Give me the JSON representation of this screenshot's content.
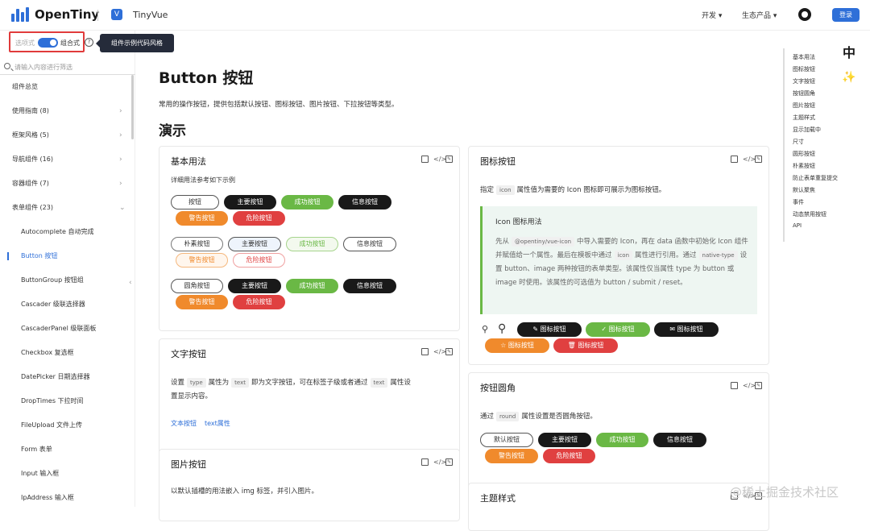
{
  "header": {
    "brand": "OpenTiny",
    "product": "TinyVue",
    "nav_dev": "开发 ▾",
    "nav_eco": "生态产品 ▾",
    "login": "登录"
  },
  "sidebar": {
    "mode_options": "选项式",
    "mode_composition": "组合式",
    "tooltip": "组件示例代码风格",
    "search_placeholder": "请输入内容进行筛选",
    "items": [
      {
        "label": "组件总览",
        "sub": false,
        "chev": ""
      },
      {
        "label": "使用指南 (8)",
        "sub": false,
        "chev": "›"
      },
      {
        "label": "框架风格 (5)",
        "sub": false,
        "chev": "›"
      },
      {
        "label": "导航组件 (16)",
        "sub": false,
        "chev": "›"
      },
      {
        "label": "容器组件 (7)",
        "sub": false,
        "chev": "›"
      },
      {
        "label": "表单组件 (23)",
        "sub": false,
        "chev": "⌄"
      },
      {
        "label": "Autocomplete 自动完成",
        "sub": true,
        "chev": ""
      },
      {
        "label": "Button 按钮",
        "sub": true,
        "chev": "",
        "active": true
      },
      {
        "label": "ButtonGroup 按钮组",
        "sub": true,
        "chev": ""
      },
      {
        "label": "Cascader 级联选择器",
        "sub": true,
        "chev": ""
      },
      {
        "label": "CascaderPanel 级联面板",
        "sub": true,
        "chev": ""
      },
      {
        "label": "Checkbox 复选框",
        "sub": true,
        "chev": ""
      },
      {
        "label": "DatePicker 日期选择器",
        "sub": true,
        "chev": ""
      },
      {
        "label": "DropTimes 下拉时间",
        "sub": true,
        "chev": ""
      },
      {
        "label": "FileUpload 文件上传",
        "sub": true,
        "chev": ""
      },
      {
        "label": "Form 表单",
        "sub": true,
        "chev": ""
      },
      {
        "label": "Input 输入框",
        "sub": true,
        "chev": ""
      },
      {
        "label": "IpAddress 输入框",
        "sub": true,
        "chev": ""
      }
    ]
  },
  "page": {
    "title": "Button 按钮",
    "desc": "常用的操作按钮，提供包括默认按钮、图标按钮、图片按钮、下拉按钮等类型。",
    "demo_heading": "演示"
  },
  "card_basic": {
    "title": "基本用法",
    "subtitle": "详细用法参考如下示例",
    "b_default": "按钮",
    "b_plain_default": "朴素按钮",
    "b_round_default": "圆角按钮",
    "b_primary": "主要按钮",
    "b_success": "成功按钮",
    "b_info": "信息按钮",
    "b_warning": "警告按钮",
    "b_danger": "危险按钮"
  },
  "card_text": {
    "title": "文字按钮",
    "t1": "设置",
    "chip_type": "type",
    "t2": "属性为",
    "chip_text": "text",
    "t3": "即为文字按钮，可在标签子级或者通过",
    "chip_text2": "text",
    "t4": "属性设",
    "t5": "置显示内容。",
    "link1": "文本按钮",
    "link2": "text属性"
  },
  "card_image": {
    "title": "图片按钮",
    "desc": "以默认插槽的用法嵌入 img 标签，并引入图片。"
  },
  "card_icon": {
    "title": "图标按钮",
    "d1": "指定",
    "chip_icon": "icon",
    "d2": "属性值为需要的 Icon 图标即可展示为图标按钮。",
    "note_title": "Icon 图标用法",
    "n1": "先从",
    "chip_pkg": "@opentiny/vue-icon",
    "n2": "中导入需要的 Icon，再在 data 函数中初始化 Icon 组件并赋值给一个属性。最后在模板中通过",
    "chip_icon2": "icon",
    "n3": "属性进行引用。通过",
    "chip_native": "native-type",
    "n4": "设置 button、image 两种按钮的表单类型。该属性仅当属性 type 为 button 或 image 时使用。该属性的可选值为 button / submit / reset。",
    "btn_label": "图标按钮"
  },
  "card_round": {
    "title": "按钮圆角",
    "d1": "通过",
    "chip_round": "round",
    "d2": "属性设置是否圆角按钮。",
    "b_default": "默认按钮",
    "b_primary": "主要按钮",
    "b_success": "成功按钮",
    "b_info": "信息按钮",
    "b_warning": "警告按钮",
    "b_danger": "危险按钮"
  },
  "card_theme": {
    "title": "主题样式"
  },
  "anchor": [
    "基本用法",
    "图标按钮",
    "文字按钮",
    "按钮圆角",
    "图片按钮",
    "主题样式",
    "显示加载中",
    "尺寸",
    "圆形按钮",
    "朴素按钮",
    "防止表单重复提交",
    "默认聚焦",
    "事件",
    "动态禁用按钮",
    "API"
  ],
  "side_tools": {
    "lang": "中"
  },
  "watermark": "@稀土掘金技术社区"
}
